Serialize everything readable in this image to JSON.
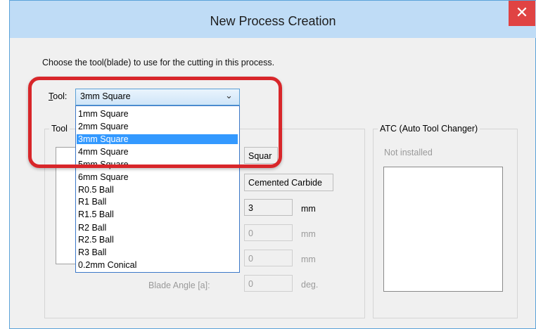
{
  "window": {
    "title": "New Process Creation",
    "close_glyph": "✕"
  },
  "instruction": "Choose the tool(blade) to use for the cutting in this process.",
  "tool": {
    "label_mnemonic": "T",
    "label_rest": "ool:",
    "selected": "3mm Square",
    "options": [
      "1mm Square",
      "2mm Square",
      "3mm Square",
      "4mm Square",
      "5mm Square",
      "6mm Square",
      "R0.5 Ball",
      "R1 Ball",
      "R1.5 Ball",
      "R2 Ball",
      "R2.5 Ball",
      "R3 Ball",
      "0.2mm Conical"
    ],
    "selected_index": 2
  },
  "tool_group_label": "Tool",
  "fields": {
    "shape": "Squar",
    "material": "Cemented Carbide",
    "diameter": "3",
    "diameter_unit": "mm",
    "f2": "0",
    "f2_unit": "mm",
    "f3": "0",
    "f3_unit": "mm",
    "blade_angle_label": "Blade Angle [a]:",
    "blade_angle": "0",
    "blade_angle_unit": "deg."
  },
  "atc": {
    "title": "ATC (Auto Tool Changer)",
    "status": "Not installed"
  },
  "colors": {
    "highlight": "#d8262a",
    "selection": "#3399ff",
    "titlebar": "#bfdcf6",
    "close": "#e04343"
  }
}
